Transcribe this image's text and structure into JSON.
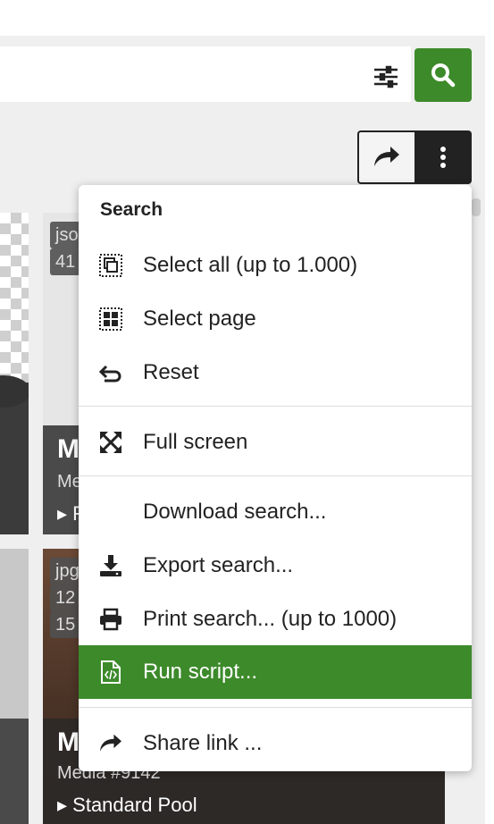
{
  "colors": {
    "accent": "#3d8a2b",
    "dark": "#222222"
  },
  "toolbar": {
    "search_icon": "search-icon",
    "filter_icon": "sliders-icon",
    "share_icon": "share-arrow-icon",
    "more_icon": "more-vertical-icon"
  },
  "tiles": {
    "a": {
      "title": "M",
      "sub": "Me",
      "pool": "F"
    },
    "b": {
      "badge1": "jso",
      "badge2": "41"
    },
    "d": {
      "badge1": "jpg",
      "badge2": "12",
      "badge3": "15",
      "title": "M",
      "sub": "Media #9142",
      "pool": "Standard Pool"
    }
  },
  "menu": {
    "heading": "Search",
    "items": [
      {
        "label": "Select all (up to 1.000)",
        "icon": "select-all-icon"
      },
      {
        "label": "Select page",
        "icon": "select-page-icon"
      },
      {
        "label": "Reset",
        "icon": "undo-icon"
      },
      {
        "label": "Full screen",
        "icon": "fullscreen-icon"
      },
      {
        "label": "Download search...",
        "icon": ""
      },
      {
        "label": "Export search...",
        "icon": "download-icon"
      },
      {
        "label": "Print search... (up to 1000)",
        "icon": "print-icon"
      },
      {
        "label": "Run script...",
        "icon": "script-file-icon"
      },
      {
        "label": "Share link ...",
        "icon": "share-arrow-icon"
      }
    ]
  }
}
